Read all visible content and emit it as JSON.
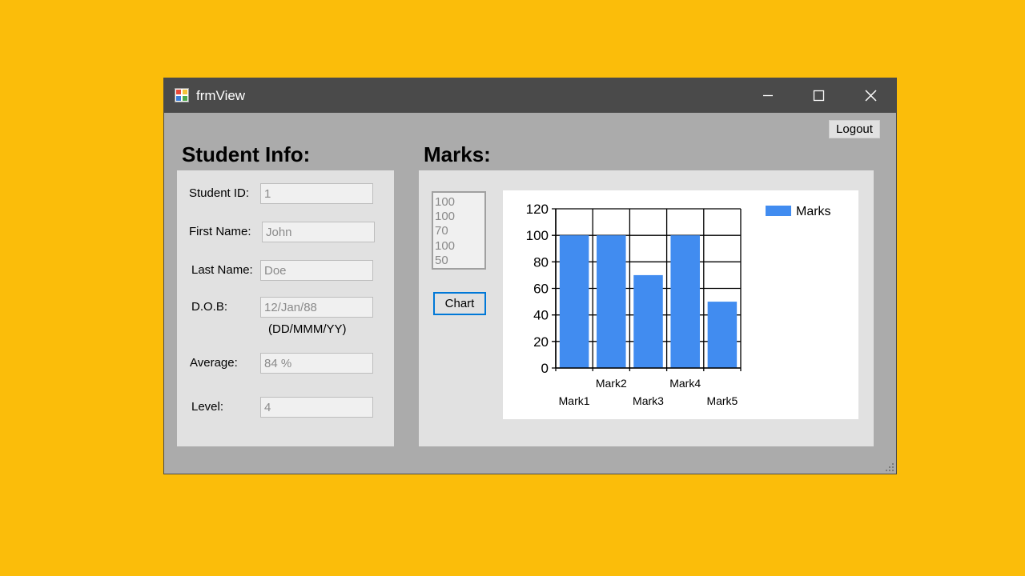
{
  "window": {
    "title": "frmView"
  },
  "logout_label": "Logout",
  "student_info": {
    "title": "Student Info:",
    "fields": {
      "student_id": {
        "label": "Student ID:",
        "value": "1"
      },
      "first_name": {
        "label": "First Name:",
        "value": "John"
      },
      "last_name": {
        "label": "Last Name:",
        "value": "Doe"
      },
      "dob": {
        "label": "D.O.B:",
        "value": "12/Jan/88",
        "hint": "(DD/MMM/YY)"
      },
      "average": {
        "label": "Average:",
        "value": "84 %"
      },
      "level": {
        "label": "Level:",
        "value": "4"
      }
    }
  },
  "marks": {
    "title": "Marks:",
    "list": [
      "100",
      "100",
      "70",
      "100",
      "50"
    ],
    "chart_button_label": "Chart"
  },
  "colors": {
    "background": "#FBBD0A",
    "titlebar": "#4A4A4A",
    "bar": "#418CF0",
    "focus_border": "#0078D7"
  },
  "chart_data": {
    "type": "bar",
    "categories": [
      "Mark1",
      "Mark2",
      "Mark3",
      "Mark4",
      "Mark5"
    ],
    "series": [
      {
        "name": "Marks",
        "values": [
          100,
          100,
          70,
          100,
          50
        ]
      }
    ],
    "ylim": [
      0,
      120
    ],
    "yticks": [
      0,
      20,
      40,
      60,
      80,
      100,
      120
    ],
    "grid": true,
    "legend": "top-right"
  }
}
